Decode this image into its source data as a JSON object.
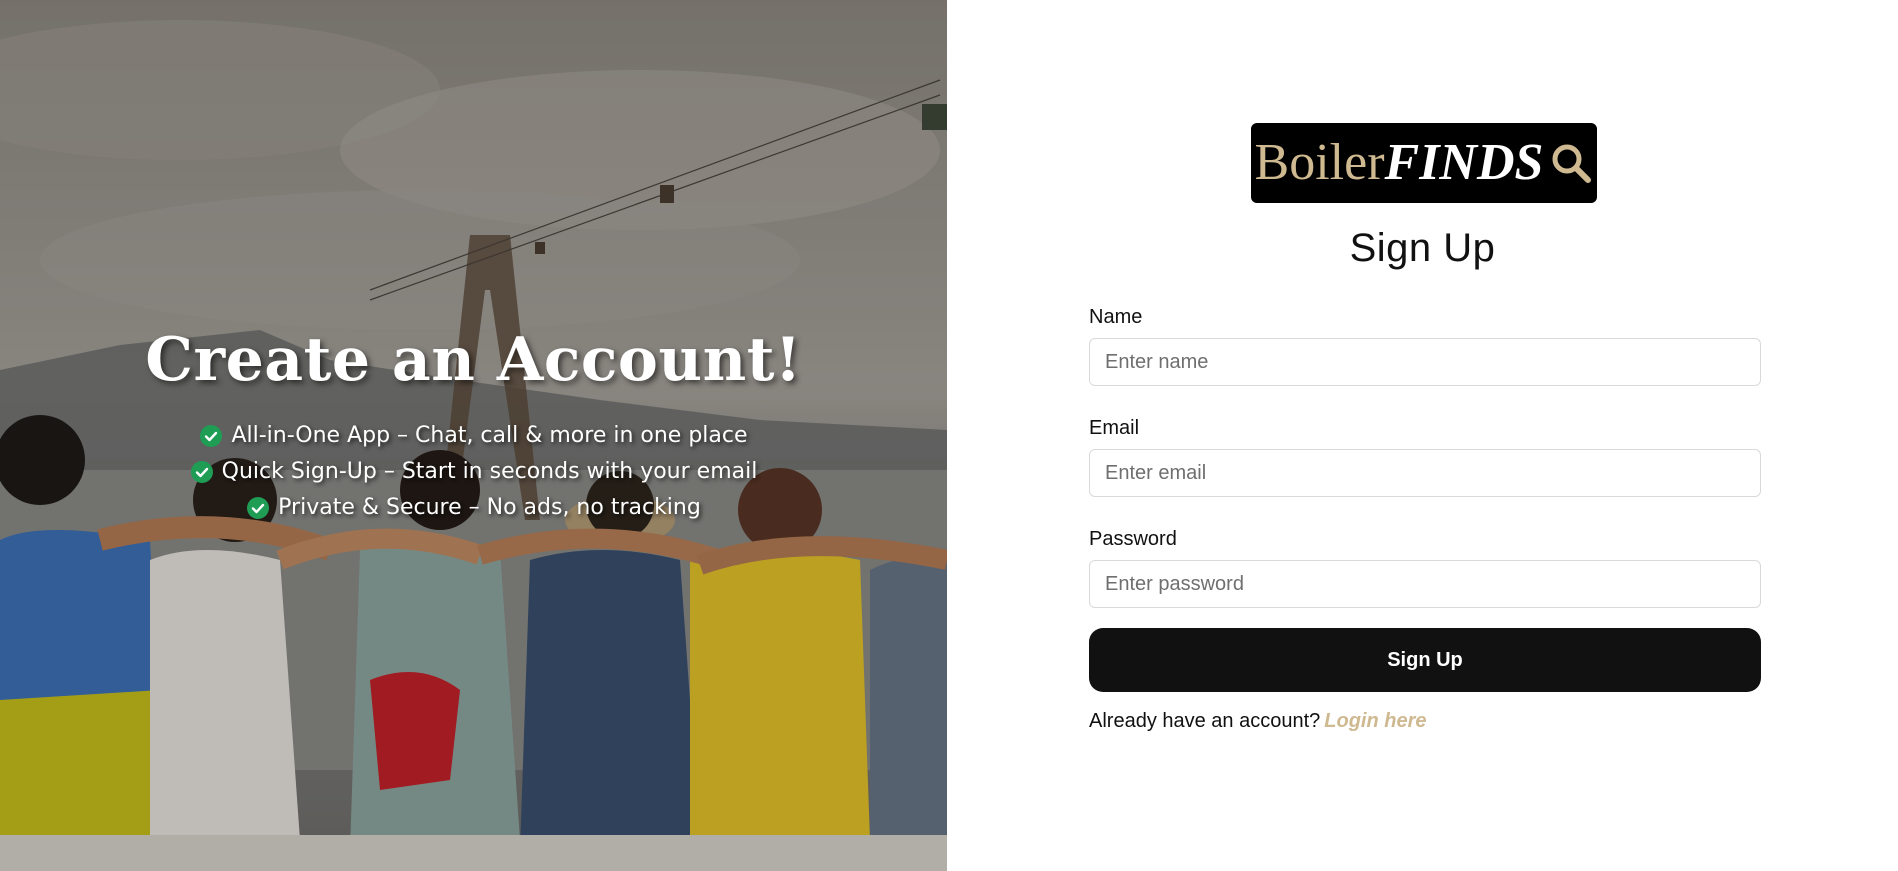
{
  "colors": {
    "brand_gold": "#cfb991",
    "brand_black": "#000000",
    "button_bg": "#111111",
    "check_green": "#1f9d55"
  },
  "hero": {
    "title": "Create an Account!",
    "features": [
      {
        "icon": "check-circle-icon",
        "text": "All-in-One App – Chat, call & more in one place"
      },
      {
        "icon": "check-circle-icon",
        "text": "Quick Sign-Up – Start in seconds with your email"
      },
      {
        "icon": "check-circle-icon",
        "text": "Private & Secure – No ads, no tracking"
      }
    ]
  },
  "logo": {
    "part1": "Boiler",
    "part2": "FINDS",
    "icon": "search-icon"
  },
  "form": {
    "title": "Sign Up",
    "name_label": "Name",
    "name_placeholder": "Enter name",
    "name_value": "",
    "email_label": "Email",
    "email_placeholder": "Enter email",
    "email_value": "",
    "password_label": "Password",
    "password_placeholder": "Enter password",
    "password_value": "",
    "submit_label": "Sign Up",
    "login_prompt": "Already have an account?",
    "login_link": "Login here"
  }
}
